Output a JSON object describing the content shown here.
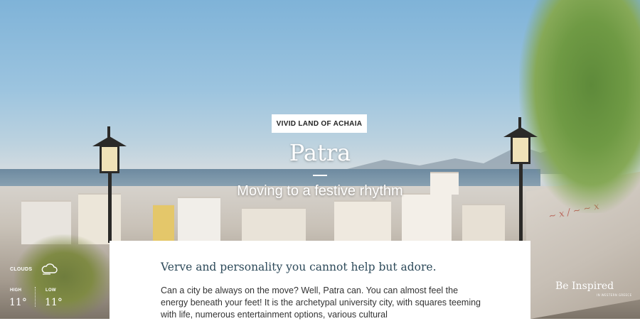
{
  "hero": {
    "tag": "VIVID LAND OF ACHAIA",
    "title": "Patra",
    "subtitle": "Moving to a festive rhythm"
  },
  "weather": {
    "condition": "CLOUDS",
    "condition_icon": "cloud-icon",
    "high_label": "HIGH",
    "high_value": "11°",
    "low_label": "LOW",
    "low_value": "11°"
  },
  "card": {
    "heading": "Verve and personality you cannot help but adore.",
    "body": "Can a city be always on the move? Well, Patra can. You can almost feel the energy beneath your feet!  It is the archetypal university city, with squares teeming with life, numerous entertainment options, various cultural"
  },
  "brand": {
    "name": "Be Inspired",
    "tagline": "IN WESTERN GREECE"
  },
  "colors": {
    "heading": "#2d4a5a",
    "body_text": "#333333",
    "tag_background": "#ffffff"
  }
}
